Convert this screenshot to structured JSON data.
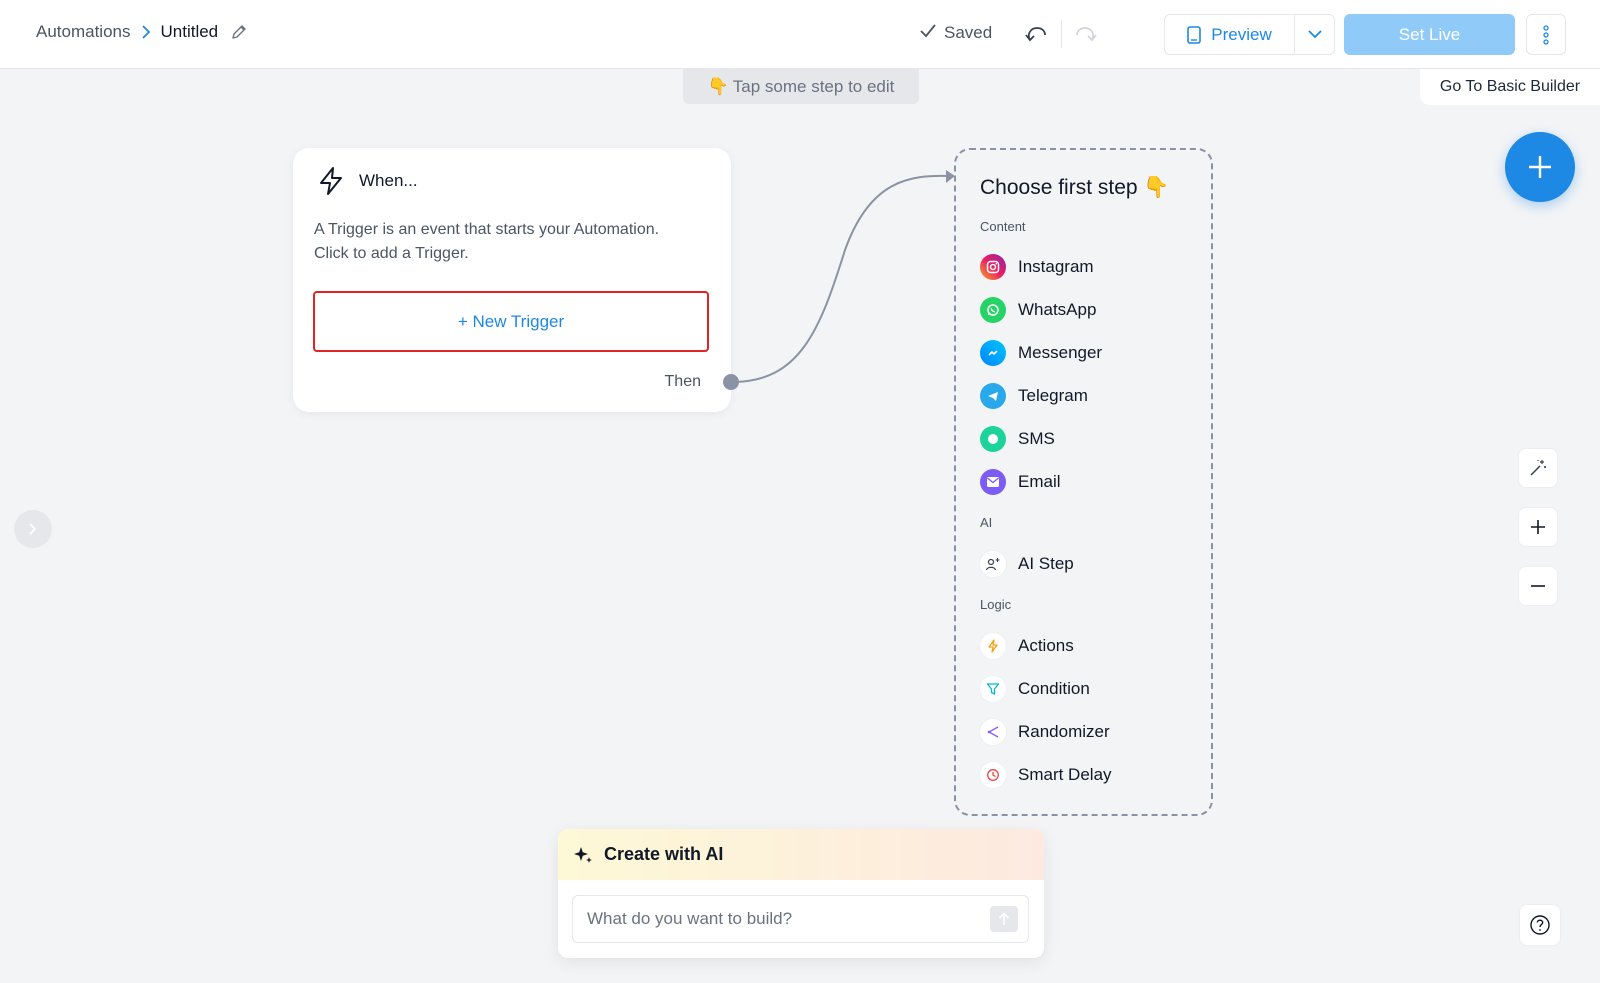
{
  "header": {
    "breadcrumb_root": "Automations",
    "breadcrumb_current": "Untitled",
    "saved_label": "Saved",
    "preview_label": "Preview",
    "set_live_label": "Set Live"
  },
  "canvas": {
    "hint_emoji": "👇",
    "hint_text": "Tap some step to edit",
    "basic_builder_label": "Go To Basic Builder"
  },
  "trigger": {
    "title": "When...",
    "description": "A Trigger is an event that starts your Automation. Click to add a Trigger.",
    "new_trigger_label": "+ New Trigger",
    "then_label": "Then"
  },
  "picker": {
    "title": "Choose first step",
    "title_emoji": "👇",
    "sections": {
      "content": "Content",
      "ai": "AI",
      "logic": "Logic"
    },
    "content_items": [
      "Instagram",
      "WhatsApp",
      "Messenger",
      "Telegram",
      "SMS",
      "Email"
    ],
    "ai_items": [
      "AI Step"
    ],
    "logic_items": [
      "Actions",
      "Condition",
      "Randomizer",
      "Smart Delay"
    ]
  },
  "ai_panel": {
    "title": "Create with AI",
    "placeholder": "What do you want to build?"
  },
  "colors": {
    "accent": "#1e88e5",
    "set_live_disabled": "#90caf9",
    "highlight_border": "#e02424",
    "canvas_bg": "#f3f4f6"
  }
}
